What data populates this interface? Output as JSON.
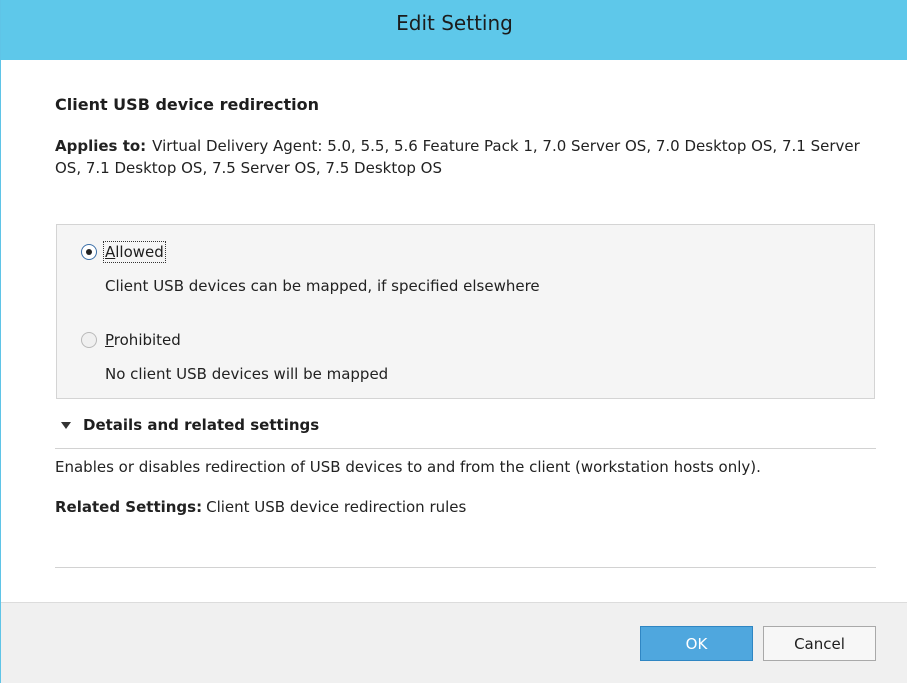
{
  "window": {
    "title": "Edit Setting"
  },
  "setting": {
    "name": "Client USB device redirection",
    "applies_label": "Applies to:",
    "applies_value": "Virtual Delivery Agent: 5.0, 5.5, 5.6 Feature Pack 1, 7.0 Server OS, 7.0 Desktop OS, 7.1 Server OS, 7.1 Desktop OS, 7.5 Server OS, 7.5 Desktop OS"
  },
  "options": [
    {
      "label_first": "A",
      "label_rest": "llowed",
      "description": "Client USB devices can be mapped, if specified elsewhere",
      "selected": true
    },
    {
      "label_first": "P",
      "label_rest": "rohibited",
      "description": "No client USB devices will be mapped",
      "selected": false
    }
  ],
  "details": {
    "header": "Details and related settings",
    "icon": "triangle-down-icon",
    "description": "Enables or disables redirection of USB devices to and from the client (workstation hosts only).",
    "related_label": "Related Settings:",
    "related_value": "Client USB device redirection rules"
  },
  "buttons": {
    "ok": "OK",
    "cancel": "Cancel"
  },
  "colors": {
    "titlebar": "#5ec8ea",
    "ok_button": "#4fa7de"
  }
}
